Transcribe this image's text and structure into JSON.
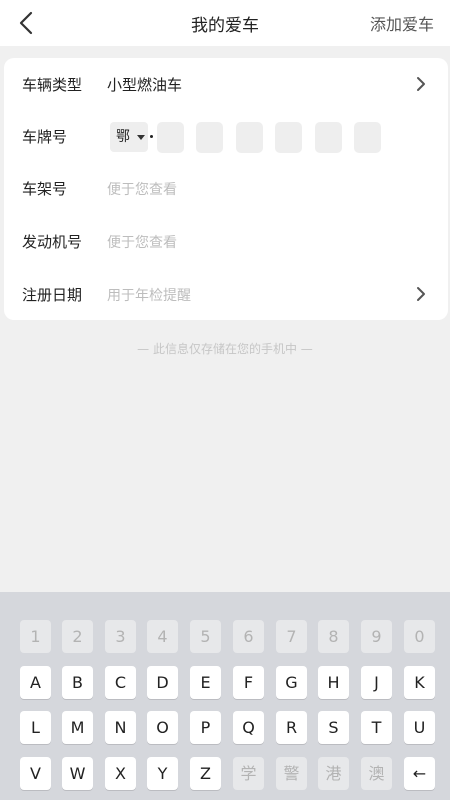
{
  "header": {
    "title": "我的爱车",
    "action": "添加爱车",
    "back_icon": "back-arrow-icon"
  },
  "form": {
    "vehicle_type": {
      "label": "车辆类型",
      "value": "小型燃油车"
    },
    "plate": {
      "label": "车牌号",
      "province": "鄂",
      "separator": "·"
    },
    "frame": {
      "label": "车架号",
      "placeholder": "便于您查看"
    },
    "engine": {
      "label": "发动机号",
      "placeholder": "便于您查看"
    },
    "register": {
      "label": "注册日期",
      "placeholder": "用于年检提醒"
    }
  },
  "note": "— 此信息仅存储在您的手机中 —",
  "keyboard": {
    "row1": [
      "1",
      "2",
      "3",
      "4",
      "5",
      "6",
      "7",
      "8",
      "9",
      "0"
    ],
    "row2": [
      "A",
      "B",
      "C",
      "D",
      "E",
      "F",
      "G",
      "H",
      "J",
      "K"
    ],
    "row3": [
      "L",
      "M",
      "N",
      "O",
      "P",
      "Q",
      "R",
      "S",
      "T",
      "U"
    ],
    "row4": [
      "V",
      "W",
      "X",
      "Y",
      "Z",
      "学",
      "警",
      "港",
      "澳",
      "←"
    ]
  }
}
